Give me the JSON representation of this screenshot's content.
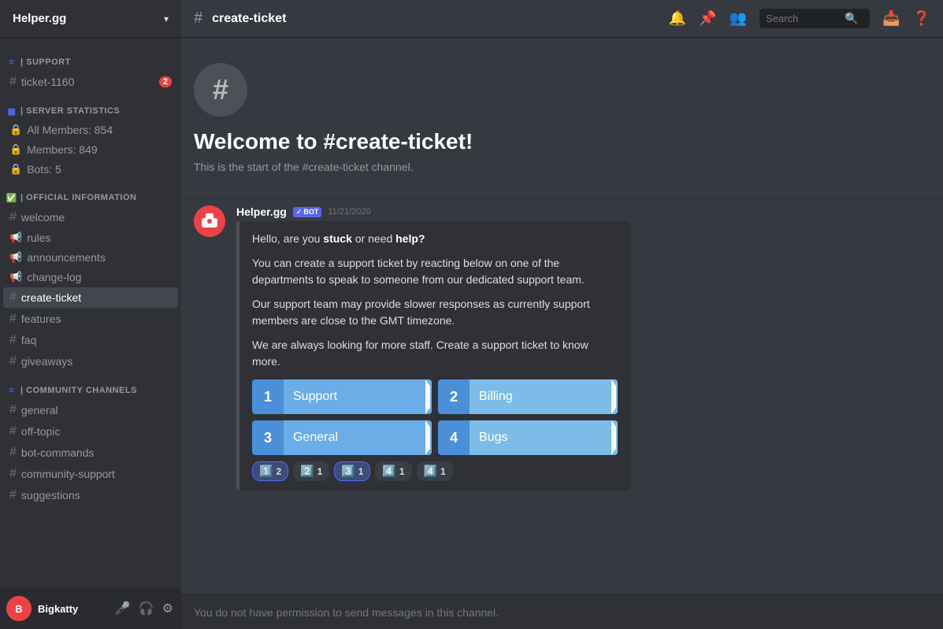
{
  "server": {
    "name": "Helper.gg",
    "chevron": "▾"
  },
  "sidebar": {
    "categories": [
      {
        "id": "support",
        "label": "| SUPPORT",
        "icon": "≡",
        "channels": [
          {
            "id": "ticket-1160",
            "label": "ticket-1160",
            "type": "text",
            "badge": "2",
            "active": false
          }
        ]
      },
      {
        "id": "server-statistics",
        "label": "| SERVER STATISTICS",
        "icon": "▦",
        "channels": [
          {
            "id": "all-members",
            "label": "All Members: 854",
            "type": "lock",
            "active": false
          },
          {
            "id": "members",
            "label": "Members: 849",
            "type": "lock",
            "active": false
          },
          {
            "id": "bots",
            "label": "Bots: 5",
            "type": "lock",
            "active": false
          }
        ]
      },
      {
        "id": "official-information",
        "label": "| OFFICIAL INFORMATION",
        "icon": "✅",
        "channels": [
          {
            "id": "welcome",
            "label": "welcome",
            "type": "text",
            "active": false
          },
          {
            "id": "rules",
            "label": "rules",
            "type": "announcement",
            "active": false
          },
          {
            "id": "announcements",
            "label": "announcements",
            "type": "announcement",
            "active": false
          },
          {
            "id": "change-log",
            "label": "change-log",
            "type": "announcement",
            "active": false
          },
          {
            "id": "create-ticket",
            "label": "create-ticket",
            "type": "text",
            "active": true
          },
          {
            "id": "features",
            "label": "features",
            "type": "text",
            "active": false
          },
          {
            "id": "faq",
            "label": "faq",
            "type": "text",
            "active": false
          },
          {
            "id": "giveaways",
            "label": "giveaways",
            "type": "text",
            "active": false
          }
        ]
      },
      {
        "id": "community-channels",
        "label": "| COMMUNITY CHANNELS",
        "icon": "≡",
        "channels": [
          {
            "id": "general",
            "label": "general",
            "type": "text",
            "active": false
          },
          {
            "id": "off-topic",
            "label": "off-topic",
            "type": "text",
            "active": false
          },
          {
            "id": "bot-commands",
            "label": "bot-commands",
            "type": "text",
            "active": false
          },
          {
            "id": "community-support",
            "label": "community-support",
            "type": "text",
            "active": false
          },
          {
            "id": "suggestions",
            "label": "suggestions",
            "type": "text",
            "active": false
          }
        ]
      }
    ]
  },
  "topbar": {
    "channel_icon": "#",
    "channel_name": "create-ticket",
    "search_placeholder": "Search"
  },
  "welcome": {
    "icon": "#",
    "title": "Welcome to #create-ticket!",
    "desc": "This is the start of the #create-ticket channel."
  },
  "message": {
    "author": "Helper.gg",
    "bot_badge": "✓ BOT",
    "time": "11/21/2020",
    "embed": {
      "line1_pre": "Hello, are you ",
      "line1_bold1": "stuck",
      "line1_mid": " or need ",
      "line1_bold2": "help?",
      "line2": "You can create a support ticket by reacting below on one of the departments to speak to someone from our dedicated support team.",
      "line3": "Our support team may provide slower responses as currently support members are close to the GMT timezone.",
      "line4": "We are always looking for more staff. Create a support ticket to know more."
    },
    "buttons": [
      {
        "num": "1",
        "label": "Support"
      },
      {
        "num": "2",
        "label": "Billing"
      },
      {
        "num": "3",
        "label": "General"
      },
      {
        "num": "4",
        "label": "Bugs"
      }
    ],
    "reactions": [
      {
        "emoji": "1️⃣",
        "count": "2",
        "active": true
      },
      {
        "emoji": "2️⃣",
        "count": "1",
        "active": false
      },
      {
        "emoji": "3️⃣",
        "count": "1",
        "active": true
      },
      {
        "emoji": "4️⃣",
        "count": "1",
        "active": false
      },
      {
        "emoji": "4️⃣",
        "count": "1",
        "active": false
      }
    ]
  },
  "footer": {
    "username": "Bigkatty",
    "no_permission_text": "You do not have permission to send messages in this channel."
  }
}
